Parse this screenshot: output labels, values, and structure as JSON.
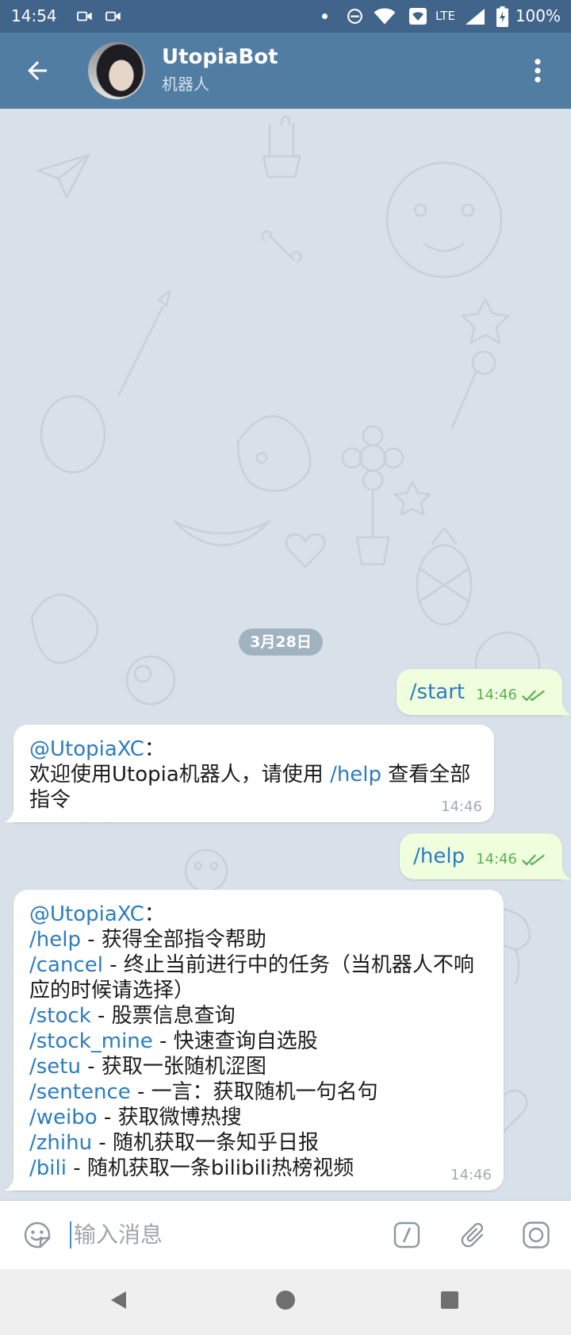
{
  "status_bar": {
    "time": "14:54",
    "network_type": "LTE",
    "battery_percent": "100%",
    "icons": [
      "video-camera-icon",
      "video-camera-icon",
      "notification-dot-icon",
      "do-not-disturb-icon",
      "wifi-icon",
      "wifi-calling-icon",
      "cell-signal-icon",
      "battery-charging-icon"
    ]
  },
  "header": {
    "title": "UtopiaBot",
    "subtitle": "机器人",
    "back_icon": "arrow-left-icon",
    "menu_icon": "more-vertical-icon"
  },
  "chat": {
    "date_separator": "3月28日",
    "messages": [
      {
        "direction": "outgoing",
        "text": "/start",
        "time": "14:46",
        "status_icon": "double-check-icon"
      },
      {
        "direction": "incoming",
        "mention": "@UtopiaXC",
        "colon": "：",
        "text_before_link": "欢迎使用Utopia机器人，请使用 ",
        "link": "/help",
        "text_after_link": " 查看全部指令",
        "time": "14:46"
      },
      {
        "direction": "outgoing",
        "text": "/help",
        "time": "14:46",
        "status_icon": "double-check-icon"
      },
      {
        "direction": "incoming",
        "mention": "@UtopiaXC",
        "colon": "：",
        "commands": [
          {
            "command": "/help",
            "description": " - 获得全部指令帮助"
          },
          {
            "command": "/cancel",
            "description": " - 终止当前进行中的任务（当机器人不响应的时候请选择）"
          },
          {
            "command": "/stock",
            "description": " - 股票信息查询"
          },
          {
            "command": "/stock_mine",
            "description": " - 快速查询自选股"
          },
          {
            "command": "/setu",
            "description": " - 获取一张随机涩图"
          },
          {
            "command": "/sentence",
            "description": " - 一言：获取随机一句名句"
          },
          {
            "command": "/weibo",
            "description": " - 获取微博热搜"
          },
          {
            "command": "/zhihu",
            "description": " - 随机获取一条知乎日报"
          },
          {
            "command": "/bili",
            "description": " - 随机获取一条bilibili热榜视频"
          }
        ],
        "time": "14:46"
      }
    ]
  },
  "composer": {
    "placeholder": "输入消息",
    "left_icon": "emoji-sticker-icon",
    "right_icons": [
      "bot-commands-slash-icon",
      "paperclip-icon",
      "camera-record-icon"
    ]
  },
  "nav_bar": {
    "icons": [
      "nav-back-icon",
      "nav-home-icon",
      "nav-recents-icon"
    ]
  },
  "colors": {
    "status_bar": "#40648a",
    "header": "#527da3",
    "chat_background": "#d8e1e9",
    "outgoing_bubble": "#effedd",
    "incoming_bubble": "#ffffff",
    "link": "#2b7cc0",
    "outgoing_time": "#5fae56",
    "incoming_time": "#a2abb4",
    "input_caret": "#3e8ed0"
  }
}
